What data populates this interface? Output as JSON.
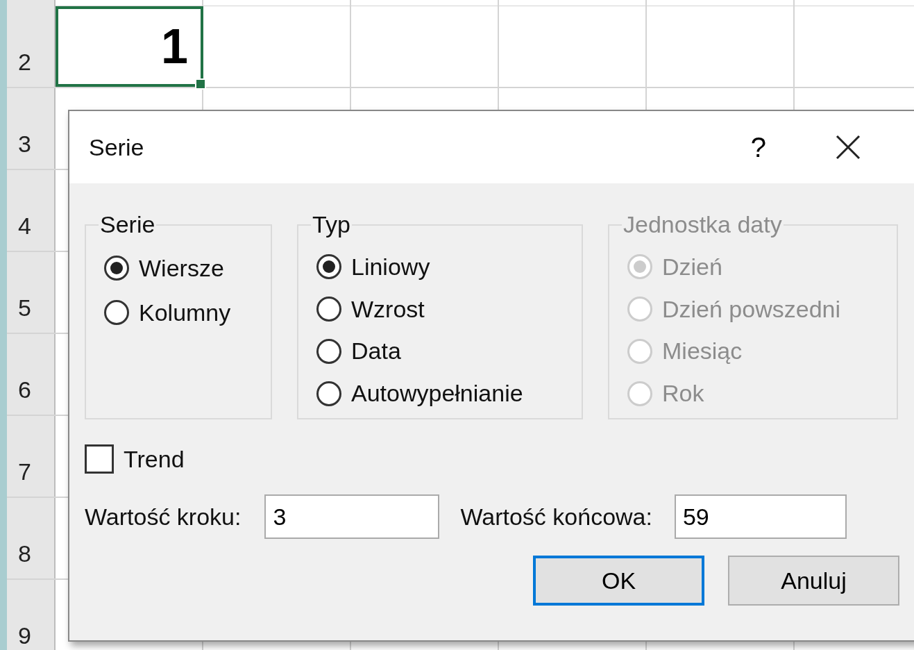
{
  "sheet": {
    "row_headers": [
      "2",
      "3",
      "4",
      "5",
      "6",
      "7",
      "8",
      "9"
    ],
    "active_cell": {
      "value": "1"
    }
  },
  "dialog": {
    "title": "Serie",
    "help": "?",
    "groups": [
      {
        "title": "Serie",
        "disabled": false,
        "options": [
          {
            "label": "Wiersze",
            "selected": true
          },
          {
            "label": "Kolumny",
            "selected": false
          }
        ]
      },
      {
        "title": "Typ",
        "disabled": false,
        "options": [
          {
            "label": "Liniowy",
            "selected": true
          },
          {
            "label": "Wzrost",
            "selected": false
          },
          {
            "label": "Data",
            "selected": false
          },
          {
            "label": "Autowypełnianie",
            "selected": false
          }
        ]
      },
      {
        "title": "Jednostka daty",
        "disabled": true,
        "options": [
          {
            "label": "Dzień",
            "selected": true
          },
          {
            "label": "Dzień powszedni",
            "selected": false
          },
          {
            "label": "Miesiąc",
            "selected": false
          },
          {
            "label": "Rok",
            "selected": false
          }
        ]
      }
    ],
    "trend": {
      "label": "Trend",
      "checked": false
    },
    "fields": [
      {
        "label": "Wartość kroku:",
        "value": "3"
      },
      {
        "label": "Wartość końcowa:",
        "value": "59"
      }
    ],
    "buttons": [
      {
        "label": "OK",
        "default": true
      },
      {
        "label": "Anuluj",
        "default": false
      }
    ]
  }
}
